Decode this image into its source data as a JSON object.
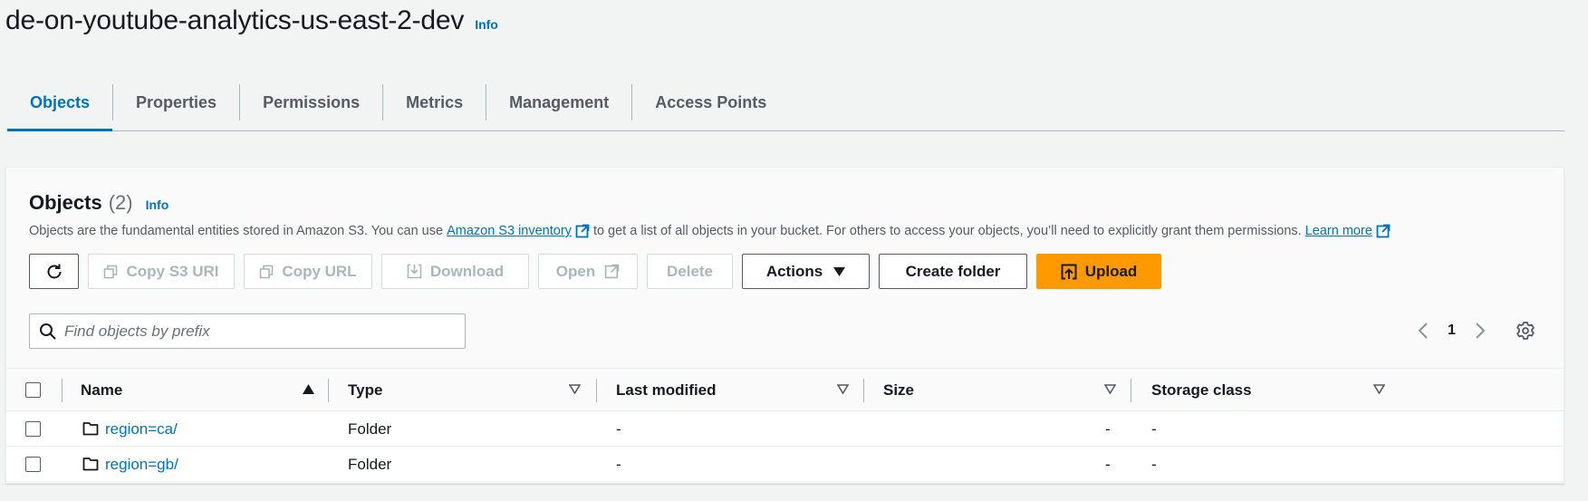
{
  "page": {
    "title": "de-on-youtube-analytics-us-east-2-dev",
    "info_label": "Info"
  },
  "tabs": [
    {
      "label": "Objects",
      "active": true
    },
    {
      "label": "Properties"
    },
    {
      "label": "Permissions"
    },
    {
      "label": "Metrics"
    },
    {
      "label": "Management"
    },
    {
      "label": "Access Points"
    }
  ],
  "objects_panel": {
    "title": "Objects",
    "count": "(2)",
    "info_label": "Info",
    "description_before": "Objects are the fundamental entities stored in Amazon S3. You can use",
    "inventory_link": "Amazon S3 inventory",
    "description_after": "to get a list of all objects in your bucket. For others to access your objects, you’ll need to explicitly grant them permissions.",
    "learn_more_link": "Learn more",
    "toolbar": {
      "refresh_icon": "refresh-icon",
      "copy_s3_uri": "Copy S3 URI",
      "copy_url": "Copy URL",
      "download": "Download",
      "open": "Open",
      "delete": "Delete",
      "actions": "Actions",
      "create_folder": "Create folder",
      "upload": "Upload"
    },
    "search": {
      "placeholder": "Find objects by prefix",
      "value": ""
    },
    "pagination": {
      "current_page": "1"
    },
    "colors": {
      "accent": "#0073bb",
      "primary_button": "#ff9900"
    }
  },
  "table": {
    "columns": [
      "Name",
      "Type",
      "Last modified",
      "Size",
      "Storage class"
    ],
    "rows": [
      {
        "name": "region=ca/",
        "type": "Folder",
        "last_modified": "-",
        "size": "-",
        "storage_class": "-"
      },
      {
        "name": "region=gb/",
        "type": "Folder",
        "last_modified": "-",
        "size": "-",
        "storage_class": "-"
      }
    ]
  }
}
